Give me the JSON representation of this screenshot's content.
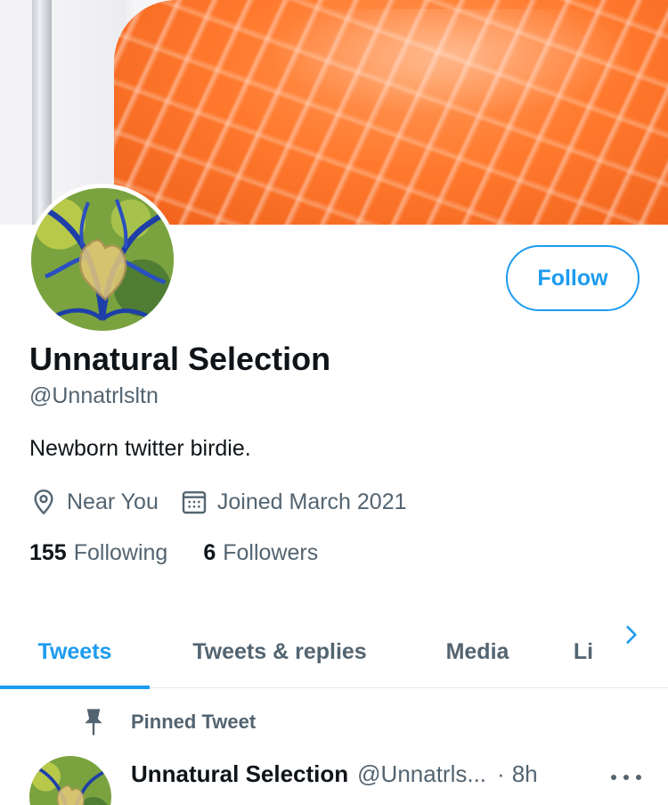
{
  "profile": {
    "follow_label": "Follow",
    "display_name": "Unnatural Selection",
    "handle": "@Unnatrlsltn",
    "bio": "Newborn twitter birdie.",
    "location": "Near You",
    "joined": "Joined March 2021",
    "following_count": "155",
    "following_label": "Following",
    "followers_count": "6",
    "followers_label": "Followers"
  },
  "tabs": [
    {
      "label": "Tweets",
      "active": true
    },
    {
      "label": "Tweets & replies",
      "active": false
    },
    {
      "label": "Media",
      "active": false
    },
    {
      "label": "Li",
      "active": false
    }
  ],
  "tweet": {
    "pinned_label": "Pinned Tweet",
    "author_name": "Unnatural Selection",
    "author_handle": "@Unnatrls...",
    "separator": "·",
    "time": "8h"
  },
  "icons": {
    "location": "location-pin-icon",
    "calendar": "calendar-icon",
    "pin": "pin-icon",
    "chevron": "chevron-right-icon",
    "more": "more-horizontal-icon"
  },
  "colors": {
    "accent": "#1d9bf0",
    "secondary_text": "#536471",
    "primary_text": "#0f1419"
  }
}
